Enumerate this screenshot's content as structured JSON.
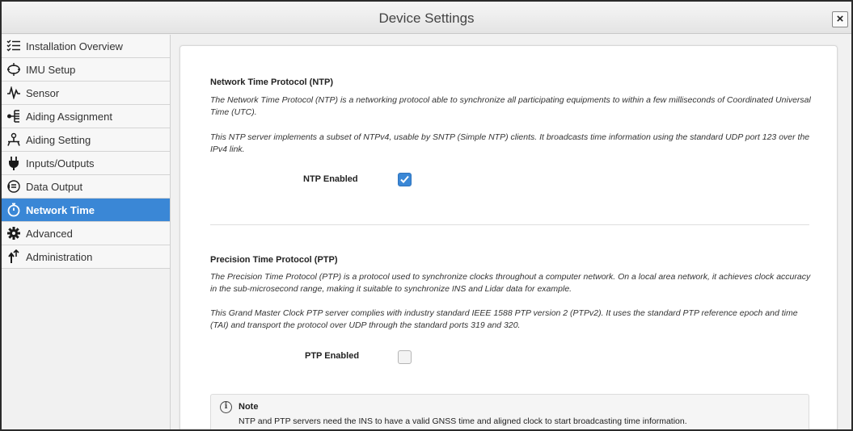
{
  "window": {
    "title": "Device Settings",
    "close_label": "×"
  },
  "sidebar": {
    "items": [
      {
        "label": "Installation Overview",
        "icon": "checklist-icon"
      },
      {
        "label": "IMU Setup",
        "icon": "imu-icon"
      },
      {
        "label": "Sensor",
        "icon": "waveform-icon"
      },
      {
        "label": "Aiding Assignment",
        "icon": "assignment-icon"
      },
      {
        "label": "Aiding Setting",
        "icon": "antenna-setting-icon"
      },
      {
        "label": "Inputs/Outputs",
        "icon": "plug-icon"
      },
      {
        "label": "Data Output",
        "icon": "data-output-icon"
      },
      {
        "label": "Network Time",
        "icon": "stopwatch-icon",
        "active": true
      },
      {
        "label": "Advanced",
        "icon": "gear-icon"
      },
      {
        "label": "Administration",
        "icon": "admin-icon"
      }
    ]
  },
  "ntp": {
    "title": "Network Time Protocol (NTP)",
    "desc1": "The Network Time Protocol (NTP) is a networking protocol able to synchronize all participating equipments to within a few milliseconds of Coordinated Universal Time (UTC).",
    "desc2": "This NTP server implements a subset of NTPv4, usable by SNTP (Simple NTP) clients. It broadcasts time information using the standard UDP port 123 over the IPv4 link.",
    "enabled_label": "NTP Enabled",
    "enabled": true
  },
  "ptp": {
    "title": "Precision Time Protocol (PTP)",
    "desc1": "The Precision Time Protocol (PTP) is a protocol used to synchronize clocks throughout a computer network. On a local area network, it achieves clock accuracy in the sub-microsecond range, making it suitable to synchronize INS and Lidar data for example.",
    "desc2": "This Grand Master Clock PTP server complies with industry standard IEEE 1588 PTP version 2 (PTPv2). It uses the standard PTP reference epoch and time (TAI) and transport the protocol over UDP through the standard ports 319 and 320.",
    "enabled_label": "PTP Enabled",
    "enabled": false
  },
  "note": {
    "icon_glyph": "i",
    "title": "Note",
    "text": "NTP and PTP servers need the INS to have a valid GNSS time and aligned clock to start broadcasting time information."
  },
  "colors": {
    "accent": "#3a87d6",
    "sidebar_bg": "#f7f7f7"
  }
}
